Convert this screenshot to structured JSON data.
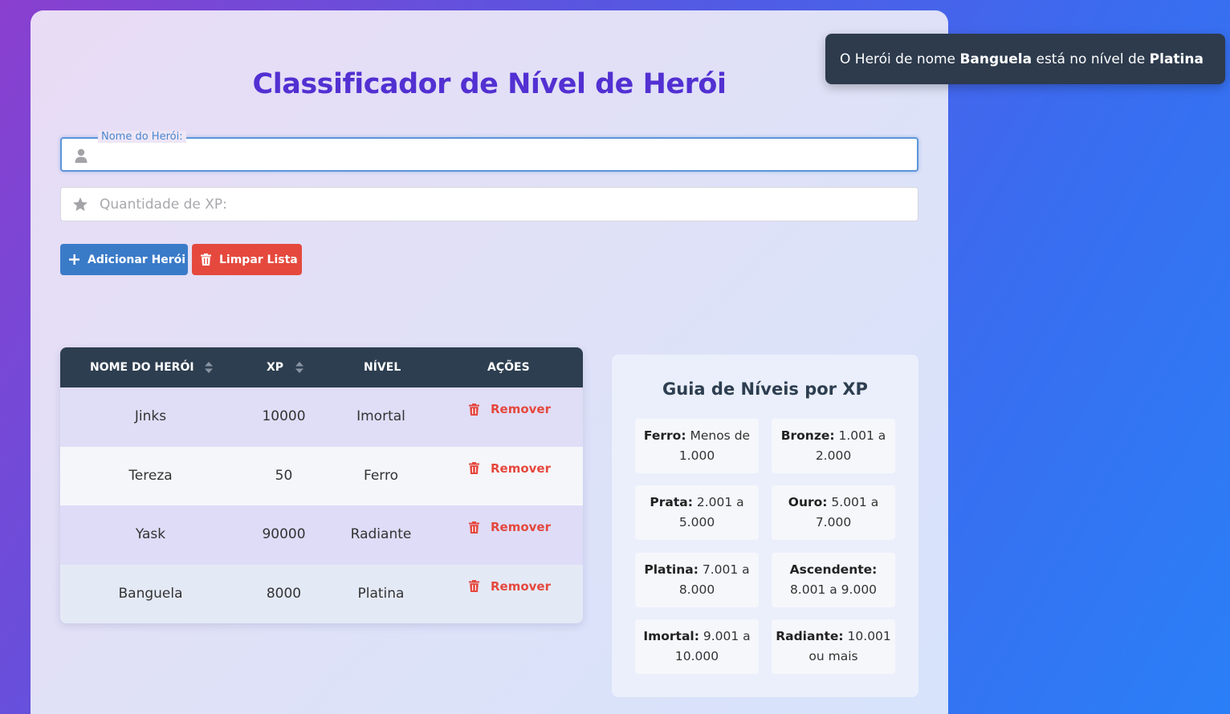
{
  "page": {
    "title": "Classificador de Nível de Herói"
  },
  "form": {
    "name_label": "Nome do Herói:",
    "name_value": "",
    "xp_placeholder": "Quantidade de XP:",
    "add_button": "Adicionar Herói",
    "clear_button": "Limpar Lista"
  },
  "table": {
    "headers": {
      "name": "NOME DO HERÓI",
      "xp": "XP",
      "level": "NÍVEL",
      "actions": "AÇÕES"
    },
    "rows": [
      {
        "name": "Jinks",
        "xp": "10000",
        "level": "Imortal",
        "action": "Remover"
      },
      {
        "name": "Tereza",
        "xp": "50",
        "level": "Ferro",
        "action": "Remover"
      },
      {
        "name": "Yask",
        "xp": "90000",
        "level": "Radiante",
        "action": "Remover"
      },
      {
        "name": "Banguela",
        "xp": "8000",
        "level": "Platina",
        "action": "Remover"
      }
    ]
  },
  "guide": {
    "title": "Guia de Níveis por XP",
    "tiers": [
      {
        "name": "Ferro:",
        "range": "Menos de 1.000"
      },
      {
        "name": "Bronze:",
        "range": "1.001 a 2.000"
      },
      {
        "name": "Prata:",
        "range": "2.001 a 5.000"
      },
      {
        "name": "Ouro:",
        "range": "5.001 a 7.000"
      },
      {
        "name": "Platina:",
        "range": "7.001 a 8.000"
      },
      {
        "name": "Ascendente:",
        "range": "8.001 a 9.000"
      },
      {
        "name": "Imortal:",
        "range": "9.001 a 10.000"
      },
      {
        "name": "Radiante:",
        "range": "10.001 ou mais"
      }
    ]
  },
  "toast": {
    "prefix": "O Herói de nome",
    "hero": "Banguela",
    "middle": "está no nível de",
    "level": "Platina"
  },
  "icons": {
    "user": "user-icon",
    "star": "star-icon",
    "plus": "plus-icon",
    "trash": "trash-icon",
    "sort": "sort-icon"
  },
  "colors": {
    "accent_title": "#5230d2",
    "primary": "#3a7bc8",
    "danger": "#e5493e",
    "dark": "#2d3e50"
  }
}
